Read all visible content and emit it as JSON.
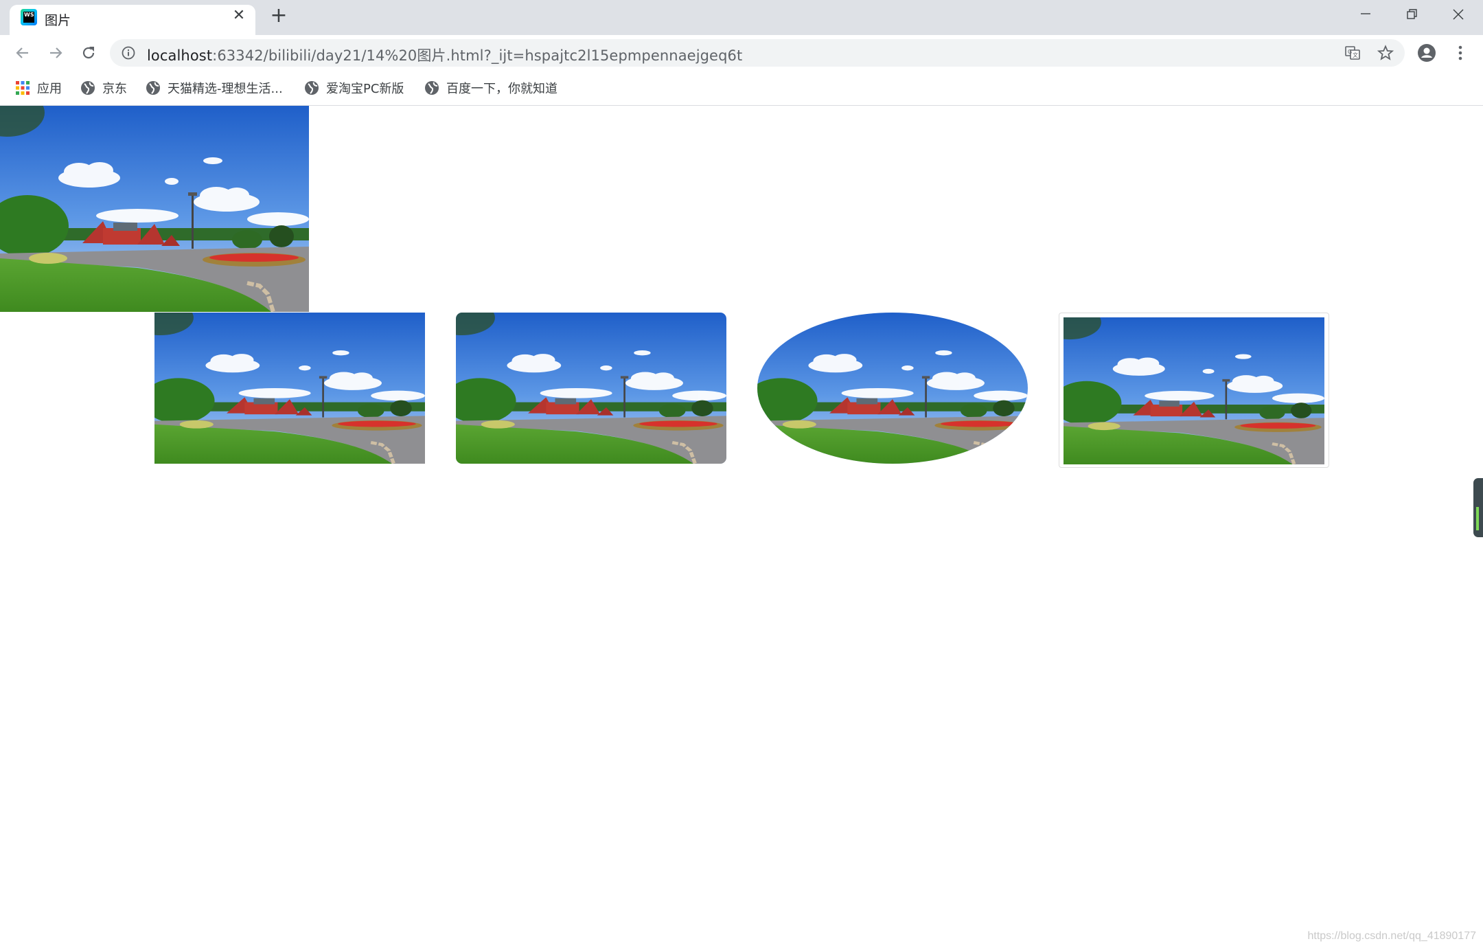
{
  "browser": {
    "tab_title": "图片",
    "favicon_text": "WS",
    "new_tab_label": "+",
    "address_host": "localhost",
    "address_rest": ":63342/bilibili/day21/14%20图片.html?_ijt=hspajtc2l15epmpennaejgeq6t",
    "icons": [
      "back-arrow-icon",
      "forward-arrow-icon",
      "reload-icon",
      "info-icon",
      "translate-icon",
      "star-icon",
      "account-icon",
      "more-vert-icon",
      "minimize-icon",
      "restore-icon",
      "close-icon"
    ]
  },
  "bookmarks": [
    {
      "label": "应用",
      "icon": "apps-grid-icon"
    },
    {
      "label": "京东",
      "icon": "globe-icon"
    },
    {
      "label": "天猫精选-理想生活...",
      "icon": "globe-icon"
    },
    {
      "label": "爱淘宝PC新版",
      "icon": "globe-icon"
    },
    {
      "label": "百度一下，你就知道",
      "icon": "globe-icon"
    }
  ],
  "page": {
    "images": [
      {
        "style": "plain"
      },
      {
        "style": "plain"
      },
      {
        "style": "rounded-corners"
      },
      {
        "style": "ellipse"
      },
      {
        "style": "thumbnail-bordered"
      }
    ],
    "watermark": "https://blog.csdn.net/qq_41890177"
  },
  "colors": {
    "tabstrip": "#dee1e6",
    "omnibox": "#f1f3f4",
    "sky": "#2f6fd4",
    "grass": "#4c9a2a",
    "building": "#b5352f"
  }
}
